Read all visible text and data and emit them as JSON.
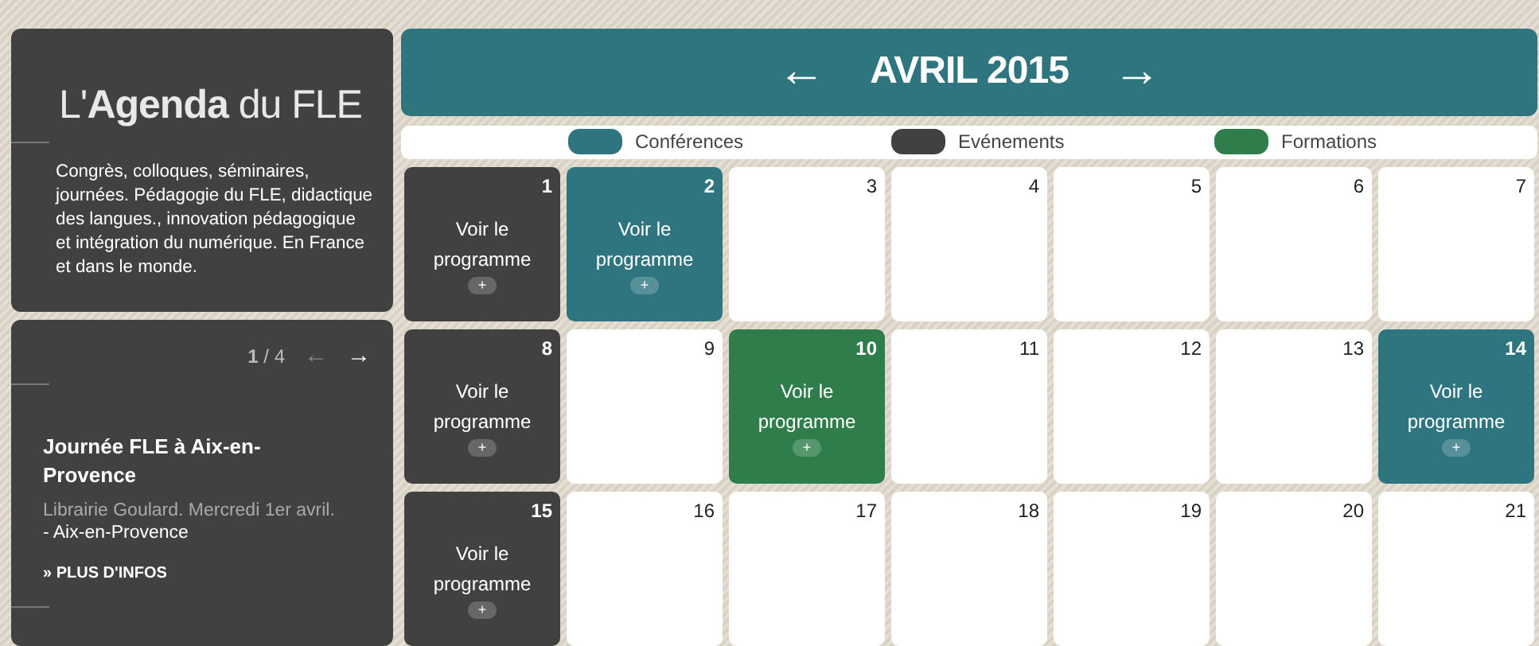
{
  "sidebar": {
    "title": "L'**Agenda** du FLE",
    "description": "Congrès, colloques, séminaires, journées. Pédagogie du FLE, didactique des langues., innovation pédagogique et intégration du numérique. En France et dans le monde.",
    "pager": {
      "position": "**1** / 4",
      "prev": {
        "label": "←",
        "disabled": true
      },
      "next": {
        "label": "→",
        "disabled": false
      }
    },
    "event": {
      "title": "Journée FLE à Aix-en-Provence",
      "place": "Librairie Goulard. Mercredi 1er avril.",
      "city": "- Aix-en-Provence",
      "link": "» PLUS D'INFOS"
    }
  },
  "calendar": {
    "prev": "←",
    "month": "AVRIL 2015",
    "next": "→",
    "legend": [
      {
        "kind": "conference",
        "label": "Conférences",
        "color": "#2e7580"
      },
      {
        "kind": "event",
        "label": "Evénements",
        "color": "#414141"
      },
      {
        "kind": "training",
        "label": "Formations",
        "color": "#2e7d4a"
      }
    ],
    "weeks": [
      [
        {
          "day": "1",
          "kind": "event",
          "link": "Voir le programme",
          "more": "+"
        },
        {
          "day": "2",
          "kind": "conference",
          "link": "Voir le programme",
          "more": "+"
        },
        {
          "day": "3",
          "kind": "none"
        },
        {
          "day": "4",
          "kind": "none"
        },
        {
          "day": "5",
          "kind": "none"
        },
        {
          "day": "6",
          "kind": "none"
        },
        {
          "day": "7",
          "kind": "none"
        }
      ],
      [
        {
          "day": "8",
          "kind": "event",
          "link": "Voir le programme",
          "more": "+"
        },
        {
          "day": "9",
          "kind": "none"
        },
        {
          "day": "10",
          "kind": "training",
          "link": "Voir le programme",
          "more": "+"
        },
        {
          "day": "11",
          "kind": "none"
        },
        {
          "day": "12",
          "kind": "none"
        },
        {
          "day": "13",
          "kind": "none"
        },
        {
          "day": "14",
          "kind": "conference",
          "link": "Voir le programme",
          "more": "+"
        }
      ],
      [
        {
          "day": "15",
          "kind": "event",
          "link": "Voir le programme",
          "more": "+"
        },
        {
          "day": "16",
          "kind": "none"
        },
        {
          "day": "17",
          "kind": "none"
        },
        {
          "day": "18",
          "kind": "none"
        },
        {
          "day": "19",
          "kind": "none"
        },
        {
          "day": "20",
          "kind": "none"
        },
        {
          "day": "21",
          "kind": "none"
        }
      ]
    ]
  }
}
